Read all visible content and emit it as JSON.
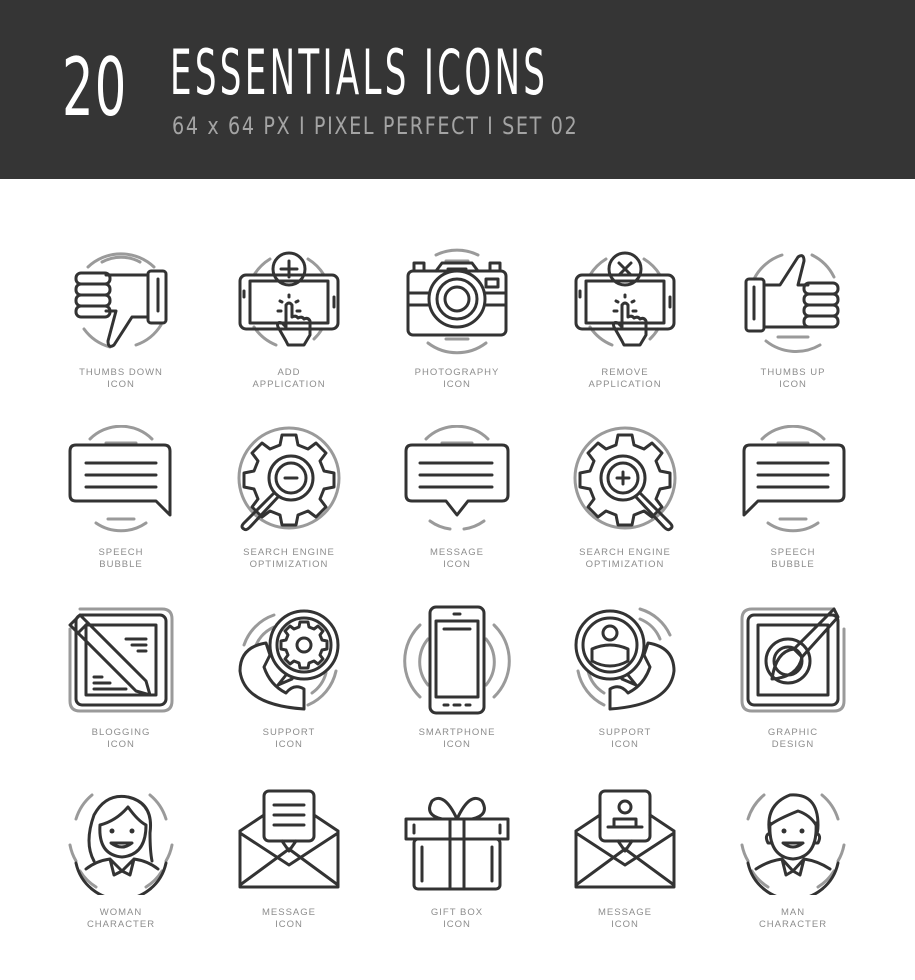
{
  "header": {
    "count": "20",
    "title": "ESSENTIALS ICONS",
    "subtitle": "64 x 64 PX  I  PIXEL PERFECT  I  SET 02"
  },
  "colors": {
    "banner": "#353535",
    "icon_stroke": "#333333",
    "accent_stroke": "#9a9a9a",
    "label": "#8d8d8d"
  },
  "icons": [
    {
      "icon": "thumbs-down-icon",
      "line1": "THUMBS DOWN",
      "line2": "ICON"
    },
    {
      "icon": "add-application-icon",
      "line1": "ADD",
      "line2": "APPLICATION"
    },
    {
      "icon": "camera-icon",
      "line1": "PHOTOGRAPHY",
      "line2": "ICON"
    },
    {
      "icon": "remove-application-icon",
      "line1": "REMOVE",
      "line2": "APPLICATION"
    },
    {
      "icon": "thumbs-up-icon",
      "line1": "THUMBS UP",
      "line2": "ICON"
    },
    {
      "icon": "speech-bubble-icon",
      "line1": "SPEECH",
      "line2": "BUBBLE"
    },
    {
      "icon": "seo-minus-icon",
      "line1": "SEARCH ENGINE",
      "line2": "OPTIMIZATION"
    },
    {
      "icon": "message-bubble-icon",
      "line1": "MESSAGE",
      "line2": "ICON"
    },
    {
      "icon": "seo-plus-icon",
      "line1": "SEARCH ENGINE",
      "line2": "OPTIMIZATION"
    },
    {
      "icon": "speech-bubble-icon",
      "line1": "SPEECH",
      "line2": "BUBBLE"
    },
    {
      "icon": "blogging-pencil-icon",
      "line1": "BLOGGING",
      "line2": "ICON"
    },
    {
      "icon": "support-gear-phone-icon",
      "line1": "SUPPORT",
      "line2": "ICON"
    },
    {
      "icon": "smartphone-icon",
      "line1": "SMARTPHONE",
      "line2": "ICON"
    },
    {
      "icon": "support-user-phone-icon",
      "line1": "SUPPORT",
      "line2": "ICON"
    },
    {
      "icon": "graphic-design-brush-icon",
      "line1": "GRAPHIC",
      "line2": "DESIGN"
    },
    {
      "icon": "woman-character-icon",
      "line1": "WOMAN",
      "line2": "CHARACTER"
    },
    {
      "icon": "envelope-message-icon",
      "line1": "MESSAGE",
      "line2": "ICON"
    },
    {
      "icon": "gift-box-icon",
      "line1": "GIFT BOX",
      "line2": "ICON"
    },
    {
      "icon": "envelope-contact-icon",
      "line1": "MESSAGE",
      "line2": "ICON"
    },
    {
      "icon": "man-character-icon",
      "line1": "MAN",
      "line2": "CHARACTER"
    }
  ]
}
